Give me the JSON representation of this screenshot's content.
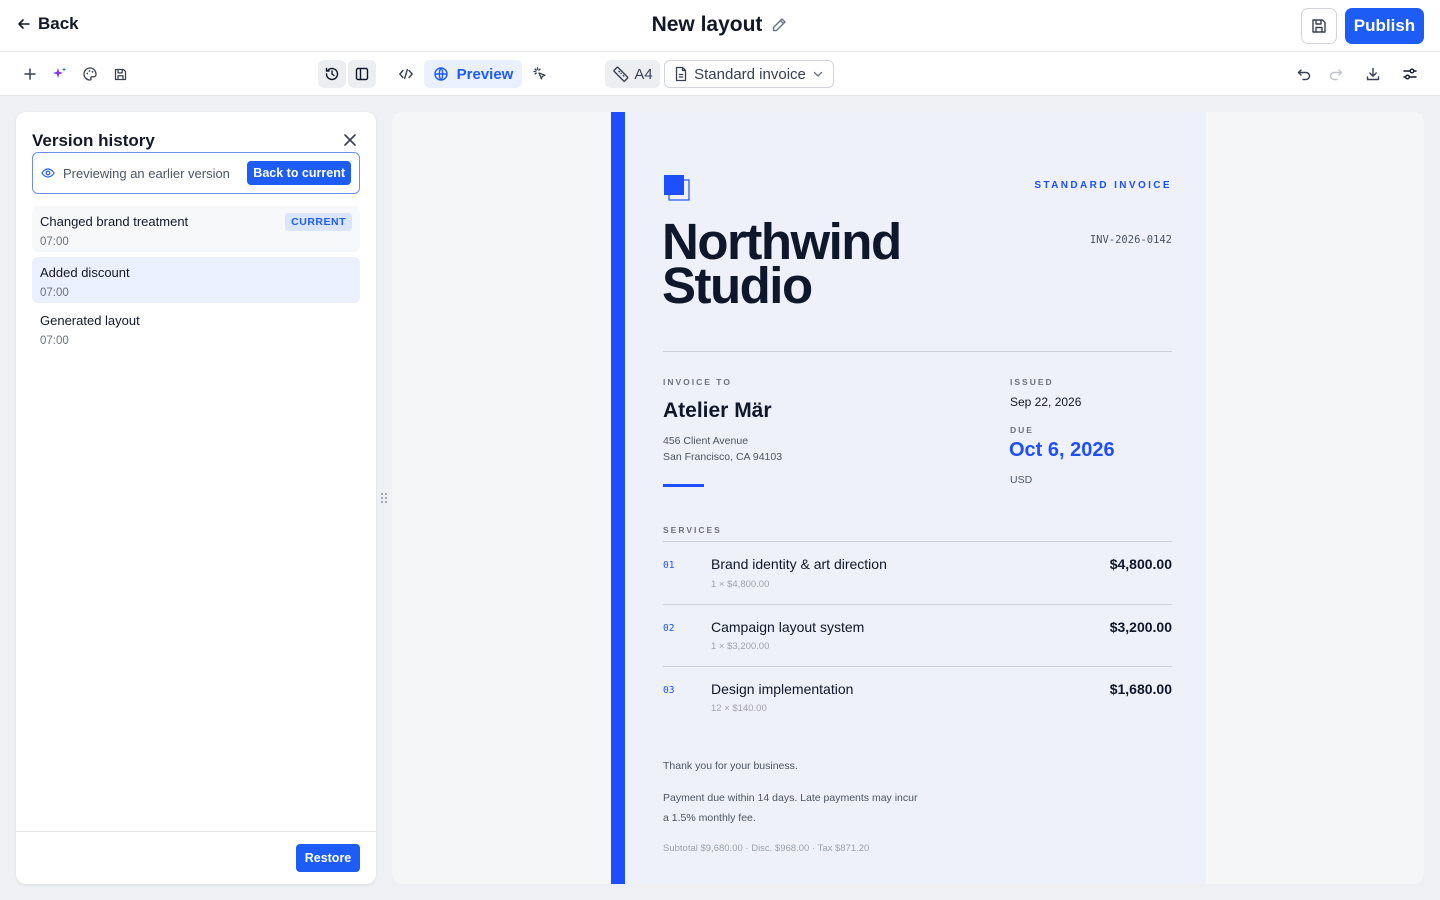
{
  "header": {
    "back_label": "Back",
    "title": "New layout",
    "publish_label": "Publish"
  },
  "toolbar": {
    "preview_label": "Preview",
    "page_size": "A4",
    "template": "Standard invoice"
  },
  "version_panel": {
    "title": "Version history",
    "notice": "Previewing an earlier version",
    "back_to_current_label": "Back to current",
    "versions": [
      {
        "name": "Changed brand treatment",
        "time": "07:00",
        "badge": "CURRENT"
      },
      {
        "name": "Added discount",
        "time": "07:00"
      },
      {
        "name": "Generated layout",
        "time": "07:00"
      }
    ],
    "restore_label": "Restore"
  },
  "invoice": {
    "doc_label": "STANDARD INVOICE",
    "company": "Northwind Studio",
    "number": "INV-2026-0142",
    "invoice_to_label": "INVOICE TO",
    "client": "Atelier Mär",
    "address_line1": "456 Client Avenue",
    "address_line2": "San Francisco, CA 94103",
    "issued_label": "ISSUED",
    "issued": "Sep 22, 2026",
    "due_label": "DUE",
    "due": "Oct 6, 2026",
    "currency": "USD",
    "services_label": "SERVICES",
    "items": [
      {
        "num": "01",
        "name": "Brand identity & art direction",
        "detail": "1 × $4,800.00",
        "amount": "$4,800.00"
      },
      {
        "num": "02",
        "name": "Campaign layout system",
        "detail": "1 × $3,200.00",
        "amount": "$3,200.00"
      },
      {
        "num": "03",
        "name": "Design implementation",
        "detail": "12 × $140.00",
        "amount": "$1,680.00"
      }
    ],
    "thanks": "Thank you for your business.",
    "terms": "Payment due within 14 days. Late payments may incur a 1.5% monthly fee.",
    "totals": "Subtotal $9,680.00 · Disc. $968.00 · Tax $871.20"
  },
  "colors": {
    "accent": "#1d5cf5",
    "invoice_accent": "#1d4fff",
    "page_background": "#eef1f9"
  },
  "icons": [
    "arrow-left-icon",
    "pencil-icon",
    "floppy-disk-icon",
    "plus-icon",
    "sparkles-icon",
    "palette-icon",
    "history-icon",
    "sidebar-icon",
    "code-icon",
    "globe-icon",
    "pointer-click-icon",
    "ruler-icon",
    "document-icon",
    "chevron-down-icon",
    "undo-icon",
    "redo-icon",
    "download-icon",
    "sliders-icon",
    "eye-icon",
    "close-icon",
    "drag-handle-icon"
  ]
}
